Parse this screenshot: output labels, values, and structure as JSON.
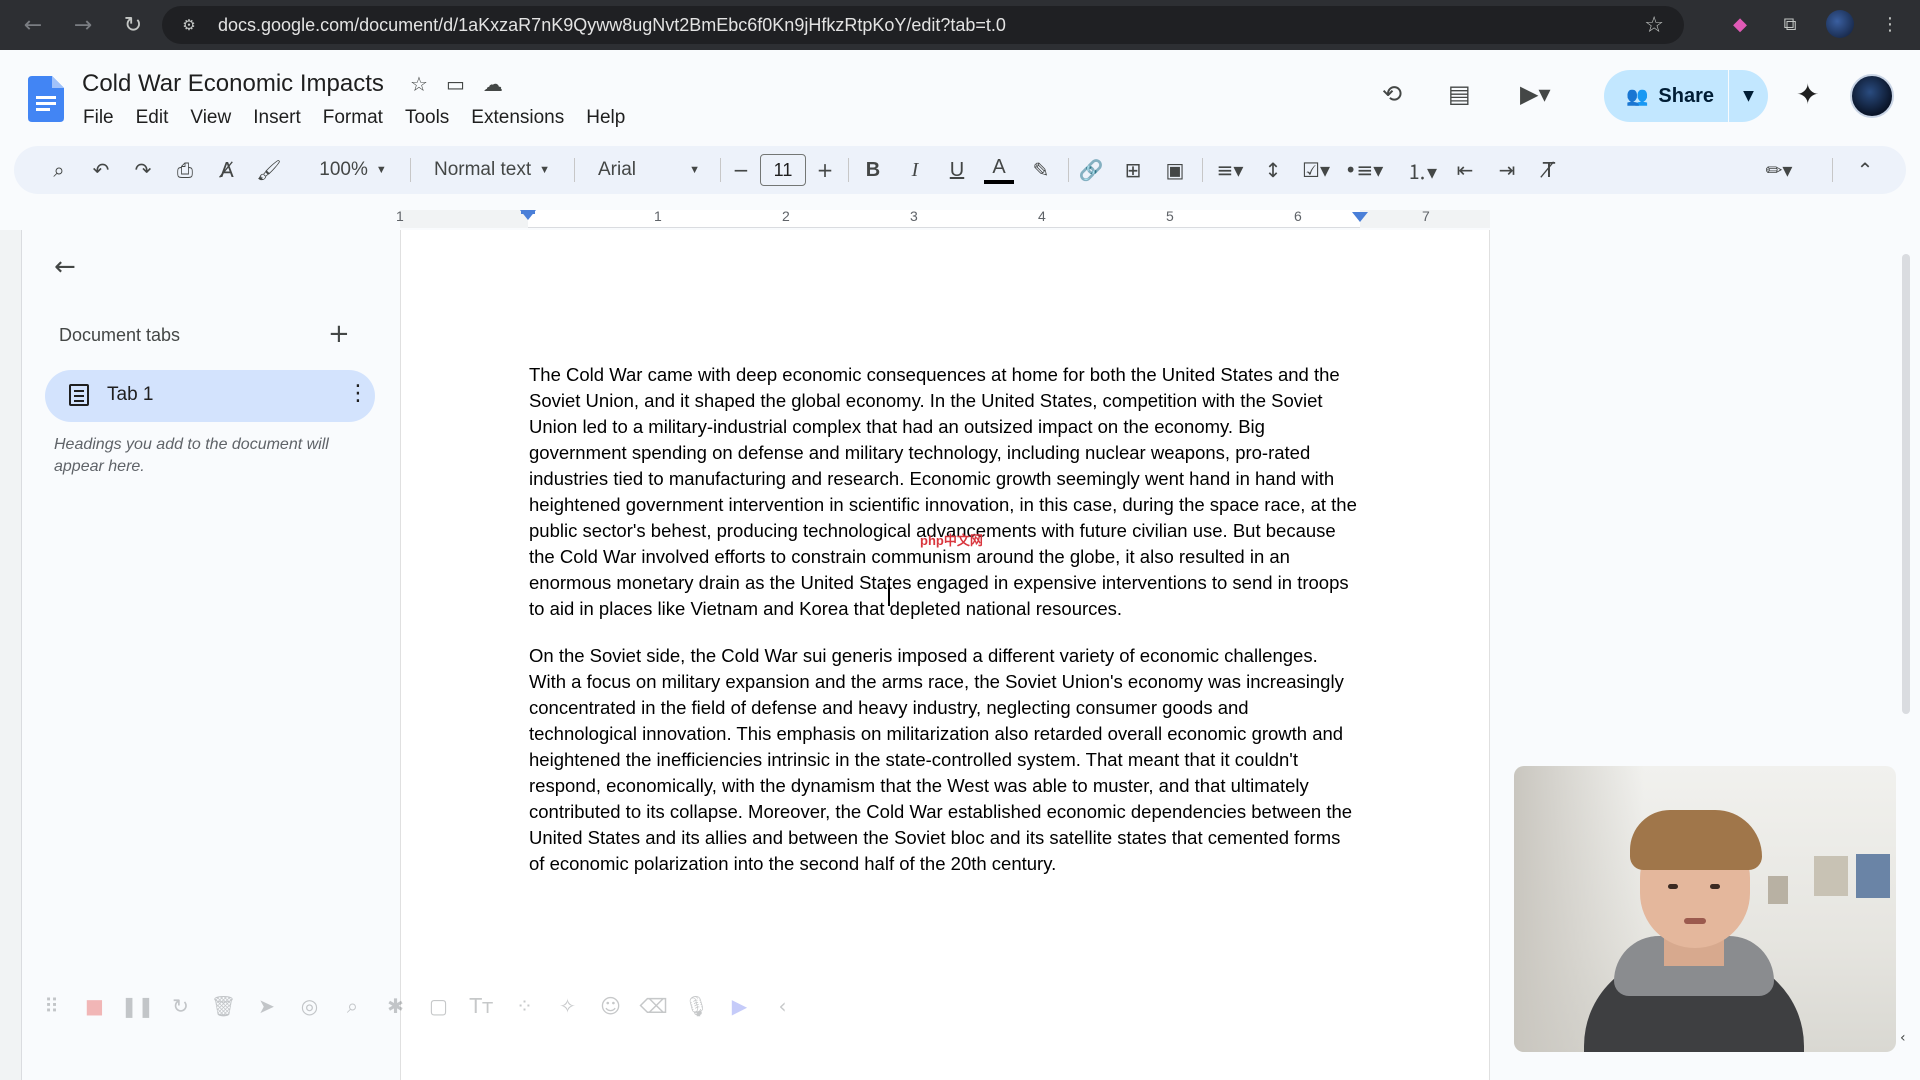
{
  "browser": {
    "url": "docs.google.com/document/d/1aKxzaR7nK9Qyww8ugNvt2BmEbc6f0Kn9jHfkzRtpKoY/edit?tab=t.0",
    "back_icon": "back-arrow-icon",
    "forward_icon": "forward-arrow-icon",
    "reload_icon": "reload-icon"
  },
  "header": {
    "title": "Cold War Economic Impacts",
    "menu": [
      "File",
      "Edit",
      "View",
      "Insert",
      "Format",
      "Tools",
      "Extensions",
      "Help"
    ],
    "share_label": "Share"
  },
  "toolbar": {
    "zoom": "100%",
    "style": "Normal text",
    "font": "Arial",
    "font_size": "11"
  },
  "ruler": {
    "numbers": [
      "1",
      "1",
      "2",
      "3",
      "4",
      "5",
      "6",
      "7"
    ]
  },
  "sidebar": {
    "tabs_header": "Document tabs",
    "tab_label": "Tab 1",
    "hint": "Headings you add to the document will appear here."
  },
  "document": {
    "paragraphs": [
      "The  Cold War came with deep economic consequences at home for both the United States and the Soviet Union, and it shaped the global economy. In the United States, competition with the  Soviet Union led to a military-industrial complex that had an outsized impact on the economy. Big government spending on defense and military technology, including nuclear weapons, pro-rated industries tied  to manufacturing and research. Economic growth seemingly went hand in hand with heightened government intervention in scientific innovation, in this case, during the  space race, at the public sector's behest, producing technological advancements with future civilian use. But because the Cold War involved efforts to constrain communism around the globe, it also resulted in an enormous monetary drain as the United States engaged in expensive interventions to send in troops to aid in places like Vietnam  and Korea that depleted national resources.",
      "On the Soviet side,  the Cold War sui generis imposed a different variety of economic challenges. With a focus on military expansion and the arms race, the Soviet Union's  economy was increasingly concentrated in the field of defense and heavy industry, neglecting consumer goods and technological innovation. This emphasis on militarization also retarded overall economic growth and  heightened the inefficiencies intrinsic in the state-controlled system. That meant that it couldn't respond, economically, with the dynamism that the West was able to muster,  and that ultimately contributed to its collapse. Moreover, the Cold War established economic dependencies between the United  States and its allies and between the Soviet bloc and its satellite states that cemented forms of economic polarization into the second half of the 20th century."
    ]
  },
  "overlay": {
    "watermark": "php中文网"
  },
  "colors": {
    "accent": "#c2e7ff",
    "tab_active": "#d3e3fd",
    "toolbar_bg": "#edf2fa",
    "chrome_bg": "#2d2f33"
  }
}
